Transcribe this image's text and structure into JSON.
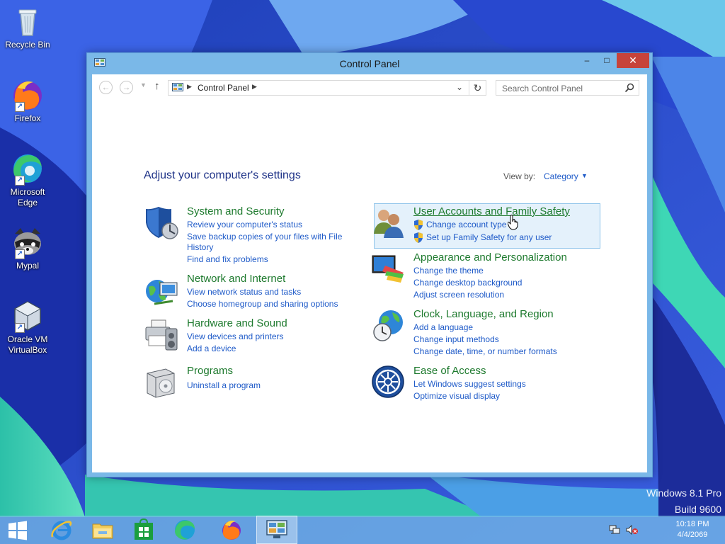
{
  "desktop": {
    "icons": [
      {
        "label": "Recycle Bin",
        "icon": "recycle-bin-icon"
      },
      {
        "label": "Firefox",
        "icon": "firefox-icon"
      },
      {
        "label": "Microsoft Edge",
        "icon": "edge-icon"
      },
      {
        "label": "Mypal",
        "icon": "mypal-icon"
      },
      {
        "label": "Oracle VM VirtualBox",
        "icon": "virtualbox-icon"
      }
    ],
    "watermark": {
      "line1": "Windows 8.1 Pro",
      "line2": "Build 9600"
    }
  },
  "window": {
    "title": "Control Panel",
    "controls": {
      "minimize": "–",
      "maximize": "□",
      "close": "✕"
    },
    "nav": {
      "back": "←",
      "forward": "→",
      "up": "↑",
      "breadcrumb": "Control Panel",
      "search_placeholder": "Search Control Panel"
    },
    "heading": "Adjust your computer's settings",
    "view_by": {
      "label": "View by:",
      "value": "Category"
    },
    "categories": {
      "system": {
        "title": "System and Security",
        "links": [
          "Review your computer's status",
          "Save backup copies of your files with File",
          "History",
          "Find and fix problems"
        ]
      },
      "network": {
        "title": "Network and Internet",
        "links": [
          "View network status and tasks",
          "Choose homegroup and sharing options"
        ]
      },
      "hardware": {
        "title": "Hardware and Sound",
        "links": [
          "View devices and printers",
          "Add a device"
        ]
      },
      "programs": {
        "title": "Programs",
        "links": [
          "Uninstall a program"
        ]
      },
      "user": {
        "title": "User Accounts and Family Safety",
        "links": [
          "Change account type",
          "Set up Family Safety for any user"
        ]
      },
      "appearance": {
        "title": "Appearance and Personalization",
        "links": [
          "Change the theme",
          "Change desktop background",
          "Adjust screen resolution"
        ]
      },
      "clock": {
        "title": "Clock, Language, and Region",
        "links": [
          "Add a language",
          "Change input methods",
          "Change date, time, or number formats"
        ]
      },
      "ease": {
        "title": "Ease of Access",
        "links": [
          "Let Windows suggest settings",
          "Optimize visual display"
        ]
      }
    }
  },
  "taskbar": {
    "items": [
      "start-icon",
      "internet-explorer-icon",
      "file-explorer-icon",
      "store-icon",
      "edge-icon",
      "firefox-icon",
      "control-panel-icon"
    ],
    "clock": {
      "time": "10:18 PM",
      "date": "4/4/2069"
    }
  },
  "colors": {
    "accent": "#1e5ac8",
    "category_title": "#1e7a2e",
    "heading": "#1e3287",
    "titlebar": "#7ab8e8"
  }
}
